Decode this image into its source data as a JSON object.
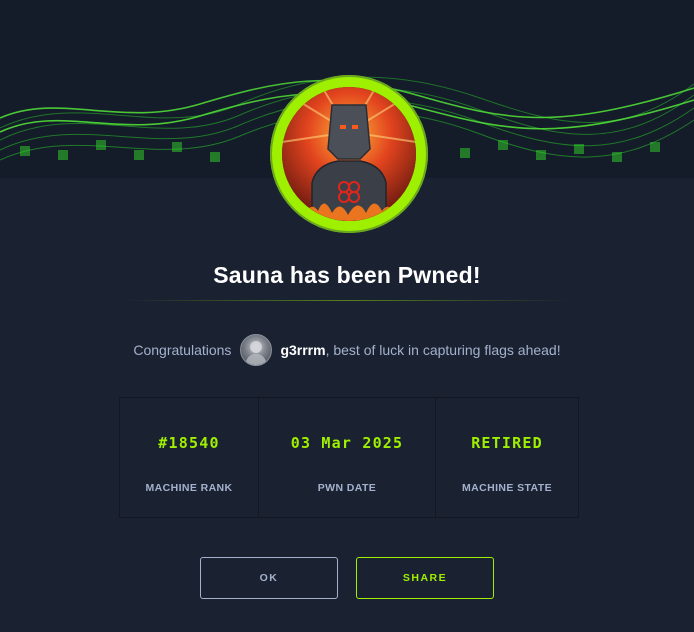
{
  "modal": {
    "title": "Sauna has been Pwned!",
    "congrats_prefix": "Congratulations",
    "username": "g3rrrm",
    "congrats_suffix": ", best of luck in capturing flags ahead!"
  },
  "stats": [
    {
      "value": "#18540",
      "label": "MACHINE RANK"
    },
    {
      "value": "03 Mar 2025",
      "label": "PWN DATE"
    },
    {
      "value": "RETIRED",
      "label": "MACHINE STATE"
    }
  ],
  "buttons": {
    "ok_label": "OK",
    "share_label": "SHARE"
  },
  "colors": {
    "background": "#1a2232",
    "accent": "#9fef00",
    "muted_text": "#a4b1cd"
  },
  "icons": {
    "banner": "green-wave-banner",
    "machine": "machine-avatar",
    "user": "user-avatar"
  }
}
